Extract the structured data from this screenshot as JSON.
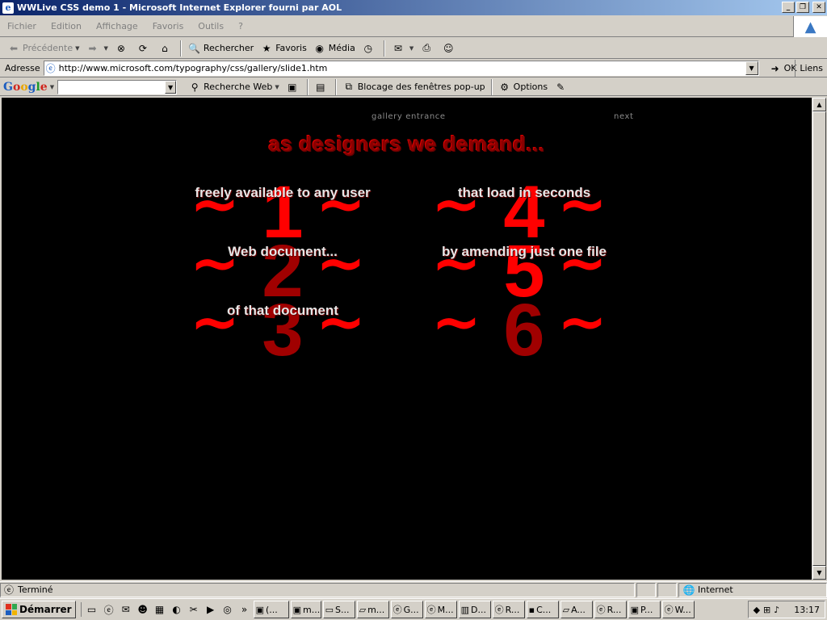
{
  "window": {
    "title": "WWLive CSS demo 1 - Microsoft Internet Explorer fourni par AOL",
    "minimize": "_",
    "maximize": "❐",
    "close": "✕"
  },
  "menubar": {
    "items": [
      "Fichier",
      "Edition",
      "Affichage",
      "Favoris",
      "Outils",
      "?"
    ]
  },
  "toolbar": {
    "back_label": "Précédente",
    "search_label": "Rechercher",
    "favorites_label": "Favoris",
    "media_label": "Média"
  },
  "address": {
    "label": "Adresse",
    "url": "http://www.microsoft.com/typography/css/gallery/slide1.htm",
    "go_label": "OK",
    "links_label": "Liens"
  },
  "googlebar": {
    "logo": [
      "G",
      "o",
      "o",
      "g",
      "l",
      "e"
    ],
    "search_value": "",
    "web_search_label": "Recherche Web",
    "popup_label": "Blocage des fenêtres pop-up",
    "options_label": "Options"
  },
  "page": {
    "nav_entrance": "gallery entrance",
    "nav_next": "next",
    "heading": "as designers we demand...",
    "items": [
      {
        "numeral": "1",
        "caption": "freely available to any user"
      },
      {
        "numeral": "4",
        "caption": "that load in seconds"
      },
      {
        "numeral": "2",
        "caption": "Web document..."
      },
      {
        "numeral": "5",
        "caption": "by amending just one file"
      },
      {
        "numeral": "3",
        "caption": "of that document"
      },
      {
        "numeral": "6",
        "caption": ""
      }
    ],
    "tilde": "~"
  },
  "statusbar": {
    "status_text": "Terminé",
    "zone_text": "Internet"
  },
  "taskbar": {
    "start_label": "Démarrer",
    "tasks": [
      "(...",
      "m...",
      "S...",
      "m...",
      "G...",
      "M...",
      "D...",
      "R...",
      "C...",
      "A...",
      "R...",
      "P...",
      "W..."
    ],
    "clock": "13:17"
  },
  "colors": {
    "page_background": "#000000",
    "heading": "#8b0000",
    "numeral": "#ff0000",
    "caption": "#e6e6e6"
  }
}
